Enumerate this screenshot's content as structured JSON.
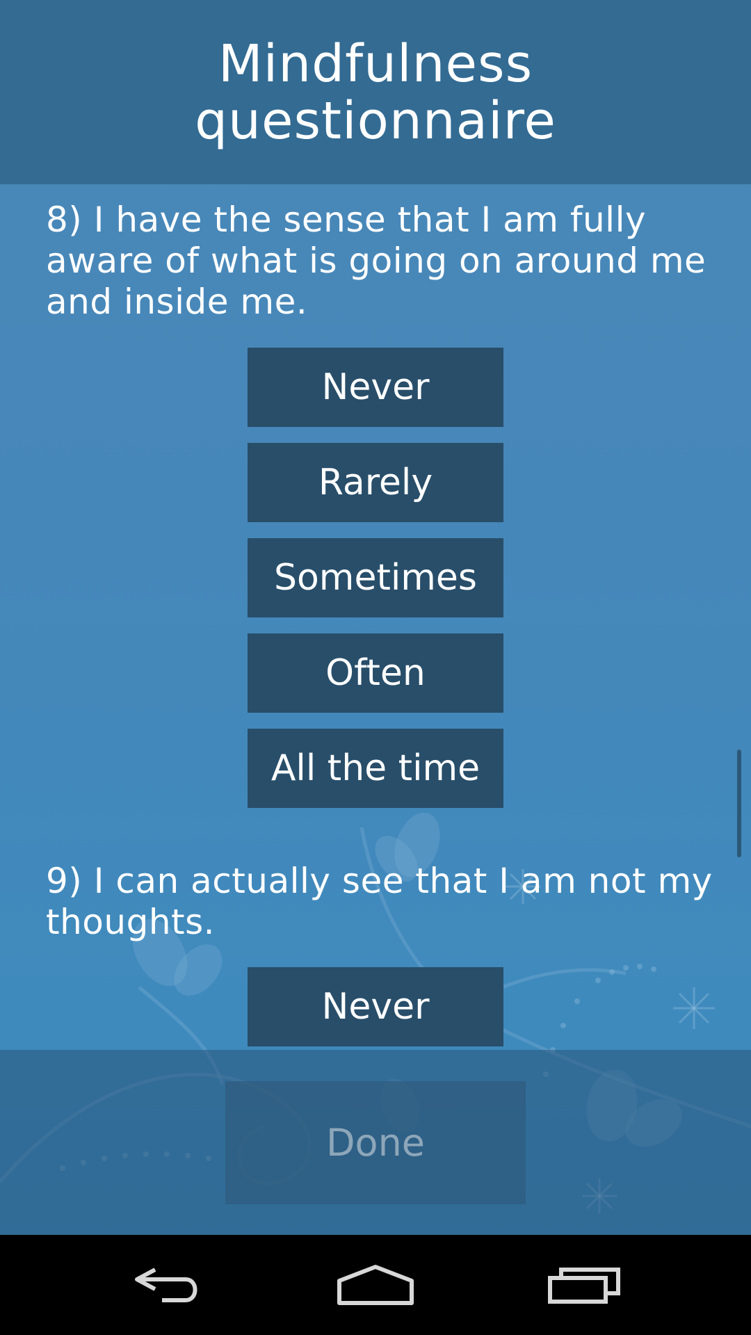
{
  "header": {
    "title_line1": "Mindfulness",
    "title_line2": "questionnaire"
  },
  "questions": [
    {
      "text": "8) I have the sense that I am fully aware of what is going on around me and inside me.",
      "options": [
        "Never",
        "Rarely",
        "Sometimes",
        "Often",
        "All the time"
      ]
    },
    {
      "text": "9) I can actually see that I am not my thoughts.",
      "options": [
        "Never"
      ]
    }
  ],
  "footer": {
    "done_label": "Done"
  },
  "navbar": {
    "icons": [
      "back-icon",
      "home-icon",
      "recent-apps-icon"
    ]
  },
  "colors": {
    "header": "#336b93",
    "content_bg": "#4687b9",
    "answer_button": "#284e6a",
    "done_text": "#8da6b9",
    "navbar": "#000000"
  }
}
